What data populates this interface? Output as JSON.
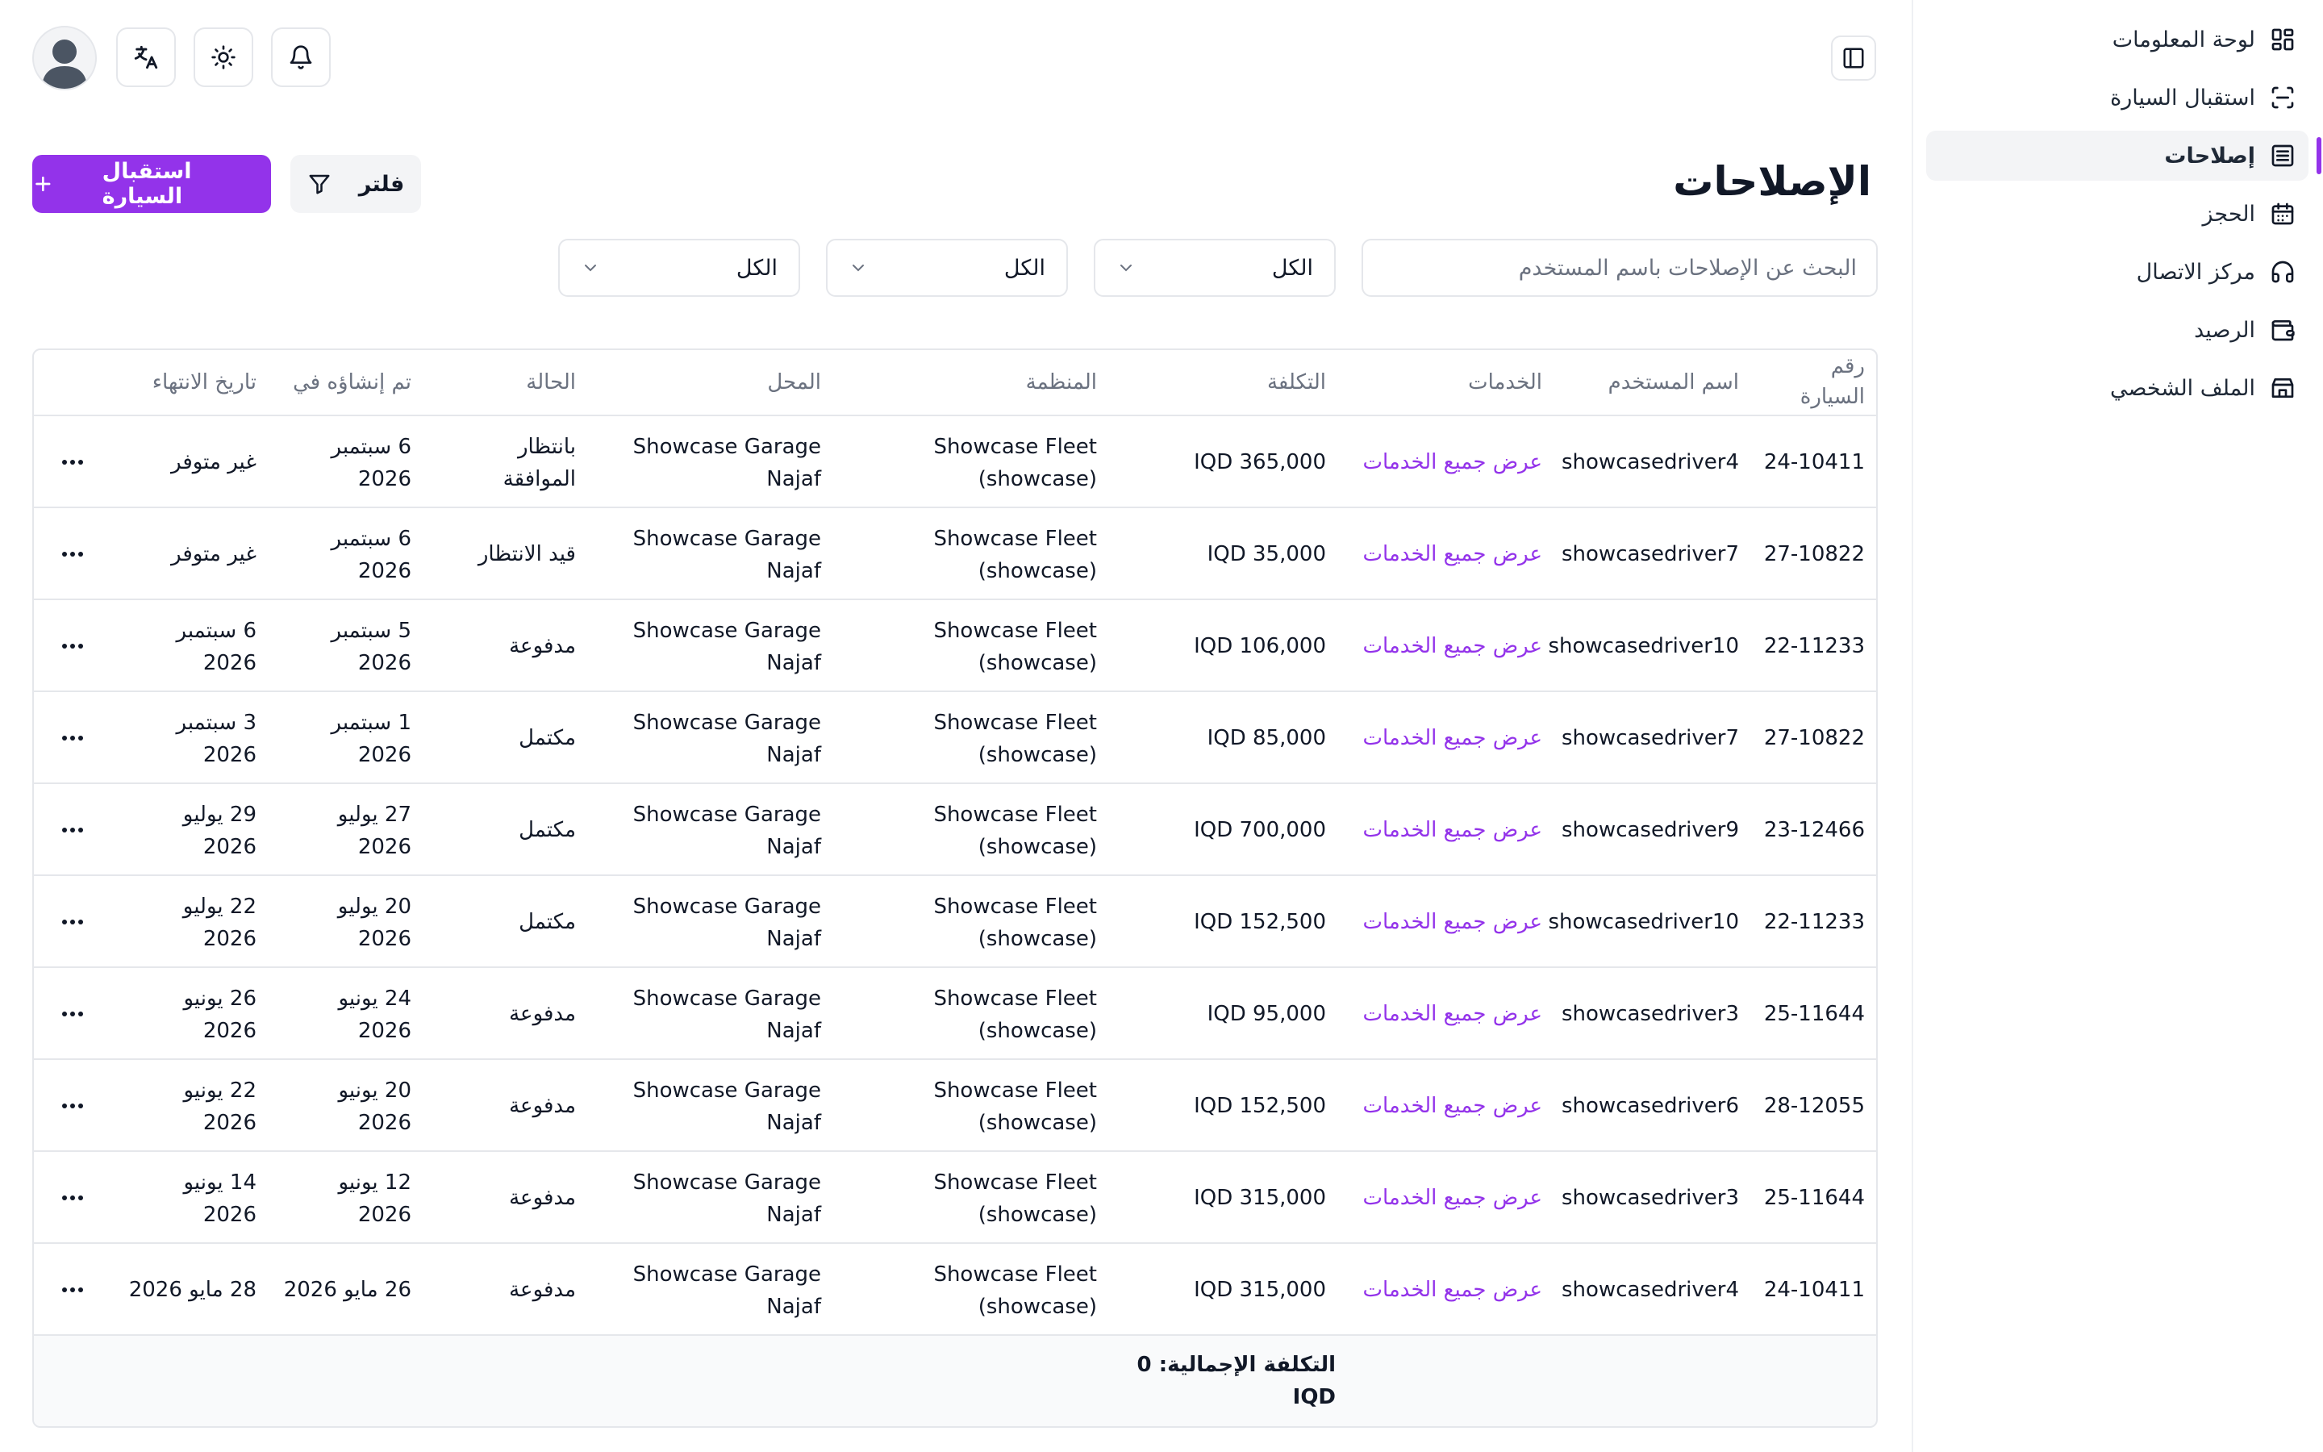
{
  "sidebar": {
    "items": [
      {
        "label": "لوحة المعلومات",
        "icon": "dashboard-icon"
      },
      {
        "label": "استقبال السيارة",
        "icon": "scan-icon"
      },
      {
        "label": "إصلاحات",
        "icon": "repairs-icon",
        "active": true
      },
      {
        "label": "الحجز",
        "icon": "calendar-icon"
      },
      {
        "label": "مركز الاتصال",
        "icon": "headset-icon"
      },
      {
        "label": "الرصيد",
        "icon": "wallet-icon"
      },
      {
        "label": "الملف الشخصي",
        "icon": "store-icon"
      }
    ]
  },
  "header": {
    "title": "الإصلاحات",
    "primary_button": "استقبال السيارة",
    "filter_button": "فلتر"
  },
  "filters": {
    "search_placeholder": "البحث عن الإصلاحات باسم المستخدم",
    "selects": [
      "الكل",
      "الكل",
      "الكل"
    ]
  },
  "table": {
    "headers": {
      "car_number_line1": "رقم",
      "car_number_line2": "السيارة",
      "username": "اسم المستخدم",
      "services": "الخدمات",
      "cost": "التكلفة",
      "organization": "المنظمة",
      "shop": "المحل",
      "status": "الحالة",
      "created": "تم إنشاؤه في",
      "ended": "تاريخ الانتهاء"
    },
    "rows": [
      {
        "car": "24-10411",
        "user": "showcasedriver4",
        "services": "عرض جميع الخدمات",
        "cost": "IQD 365,000",
        "org1": "Showcase Fleet",
        "org2": "(showcase)",
        "shop1": "Showcase Garage",
        "shop2": "Najaf",
        "status1": "بانتظار",
        "status2": "الموافقة",
        "created1": "6 سبتمبر",
        "created2": "2026",
        "ended1": "غير متوفر",
        "ended2": ""
      },
      {
        "car": "27-10822",
        "user": "showcasedriver7",
        "services": "عرض جميع الخدمات",
        "cost": "IQD 35,000",
        "org1": "Showcase Fleet",
        "org2": "(showcase)",
        "shop1": "Showcase Garage",
        "shop2": "Najaf",
        "status1": "قيد الانتظار",
        "status2": "",
        "created1": "6 سبتمبر",
        "created2": "2026",
        "ended1": "غير متوفر",
        "ended2": ""
      },
      {
        "car": "22-11233",
        "user": "showcasedriver10",
        "services": "عرض جميع الخدمات",
        "cost": "IQD 106,000",
        "org1": "Showcase Fleet",
        "org2": "(showcase)",
        "shop1": "Showcase Garage",
        "shop2": "Najaf",
        "status1": "مدفوعة",
        "status2": "",
        "created1": "5 سبتمبر",
        "created2": "2026",
        "ended1": "6 سبتمبر",
        "ended2": "2026"
      },
      {
        "car": "27-10822",
        "user": "showcasedriver7",
        "services": "عرض جميع الخدمات",
        "cost": "IQD 85,000",
        "org1": "Showcase Fleet",
        "org2": "(showcase)",
        "shop1": "Showcase Garage",
        "shop2": "Najaf",
        "status1": "مكتمل",
        "status2": "",
        "created1": "1 سبتمبر",
        "created2": "2026",
        "ended1": "3 سبتمبر",
        "ended2": "2026"
      },
      {
        "car": "23-12466",
        "user": "showcasedriver9",
        "services": "عرض جميع الخدمات",
        "cost": "IQD 700,000",
        "org1": "Showcase Fleet",
        "org2": "(showcase)",
        "shop1": "Showcase Garage",
        "shop2": "Najaf",
        "status1": "مكتمل",
        "status2": "",
        "created1": "27 يوليو",
        "created2": "2026",
        "ended1": "29 يوليو",
        "ended2": "2026"
      },
      {
        "car": "22-11233",
        "user": "showcasedriver10",
        "services": "عرض جميع الخدمات",
        "cost": "IQD 152,500",
        "org1": "Showcase Fleet",
        "org2": "(showcase)",
        "shop1": "Showcase Garage",
        "shop2": "Najaf",
        "status1": "مكتمل",
        "status2": "",
        "created1": "20 يوليو",
        "created2": "2026",
        "ended1": "22 يوليو",
        "ended2": "2026"
      },
      {
        "car": "25-11644",
        "user": "showcasedriver3",
        "services": "عرض جميع الخدمات",
        "cost": "IQD 95,000",
        "org1": "Showcase Fleet",
        "org2": "(showcase)",
        "shop1": "Showcase Garage",
        "shop2": "Najaf",
        "status1": "مدفوعة",
        "status2": "",
        "created1": "24 يونيو",
        "created2": "2026",
        "ended1": "26 يونيو",
        "ended2": "2026"
      },
      {
        "car": "28-12055",
        "user": "showcasedriver6",
        "services": "عرض جميع الخدمات",
        "cost": "IQD 152,500",
        "org1": "Showcase Fleet",
        "org2": "(showcase)",
        "shop1": "Showcase Garage",
        "shop2": "Najaf",
        "status1": "مدفوعة",
        "status2": "",
        "created1": "20 يونيو",
        "created2": "2026",
        "ended1": "22 يونيو",
        "ended2": "2026"
      },
      {
        "car": "25-11644",
        "user": "showcasedriver3",
        "services": "عرض جميع الخدمات",
        "cost": "IQD 315,000",
        "org1": "Showcase Fleet",
        "org2": "(showcase)",
        "shop1": "Showcase Garage",
        "shop2": "Najaf",
        "status1": "مدفوعة",
        "status2": "",
        "created1": "12 يونيو",
        "created2": "2026",
        "ended1": "14 يونيو",
        "ended2": "2026"
      },
      {
        "car": "24-10411",
        "user": "showcasedriver4",
        "services": "عرض جميع الخدمات",
        "cost": "IQD 315,000",
        "org1": "Showcase Fleet",
        "org2": "(showcase)",
        "shop1": "Showcase Garage",
        "shop2": "Najaf",
        "status1": "مدفوعة",
        "status2": "",
        "created1": "26 مايو 2026",
        "created2": "",
        "ended1": "28 مايو 2026",
        "ended2": ""
      }
    ],
    "total_line1": "التكلفة الإجمالية: 0",
    "total_line2": "IQD"
  },
  "colors": {
    "accent": "#9333ea",
    "border": "#e5e7eb",
    "muted": "#6b7280"
  }
}
